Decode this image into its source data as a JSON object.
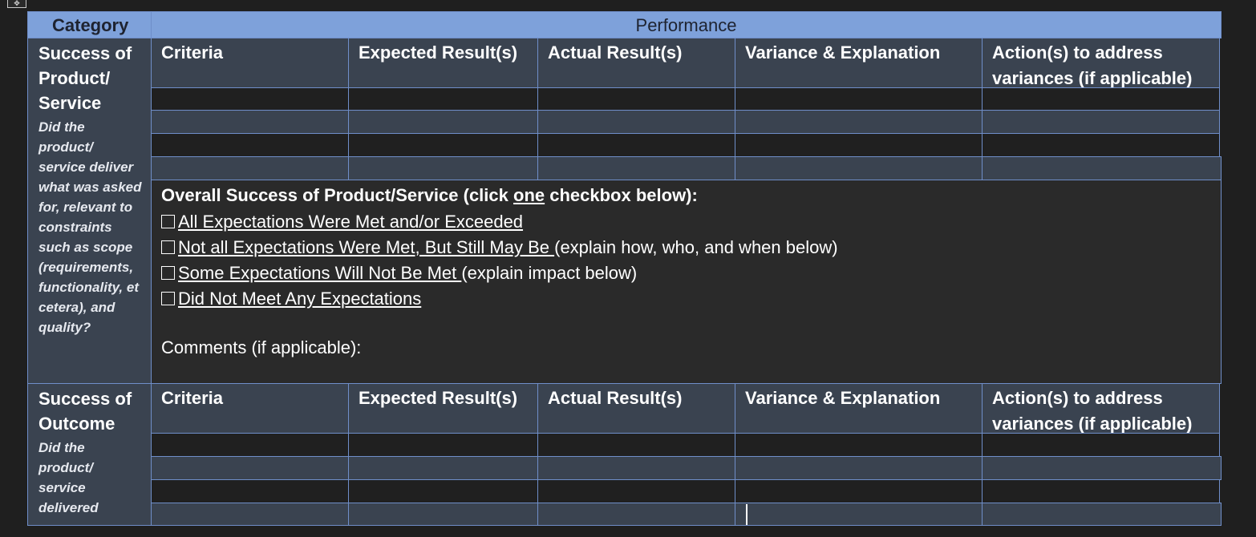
{
  "table": {
    "header": {
      "category": "Category",
      "performance": "Performance"
    },
    "columns": [
      "Criteria",
      "Expected Result(s)",
      "Actual Result(s)",
      "Variance & Explanation",
      "Action(s) to address variances (if applicable)"
    ],
    "product_section": {
      "title": "Success of Product/ Service",
      "description": "Did the product/ service deliver what was asked for, relevant to constraints such as scope (requirements, functionality, et cetera), and quality?"
    },
    "overall": {
      "heading_prefix": "Overall Success of Product/Service (click ",
      "heading_emphasis": "one",
      "heading_suffix": " checkbox below):",
      "options": [
        {
          "checked": false,
          "underlined": "All Expectations Were Met and/or Exceeded",
          "rest": ""
        },
        {
          "checked": false,
          "underlined": "Not all Expectations Were Met, But Still May Be ",
          "rest": "(explain how, who, and when below)"
        },
        {
          "checked": false,
          "underlined": "Some Expectations Will Not Be Met ",
          "rest": "(explain impact below)"
        },
        {
          "checked": false,
          "underlined": "Did Not Meet Any Expectations",
          "rest": ""
        }
      ],
      "comments_label": "Comments (if applicable):"
    },
    "outcome_section": {
      "title": "Success of Outcome",
      "description": "Did the product/ service delivered"
    }
  },
  "colors": {
    "header_band": "#7ea1da",
    "cell_dark": "#3a4350",
    "cell_black": "#202020",
    "border": "#6f8ec9"
  },
  "icons": {
    "table_handle": "move-handle-icon",
    "checkbox": "checkbox-icon"
  }
}
